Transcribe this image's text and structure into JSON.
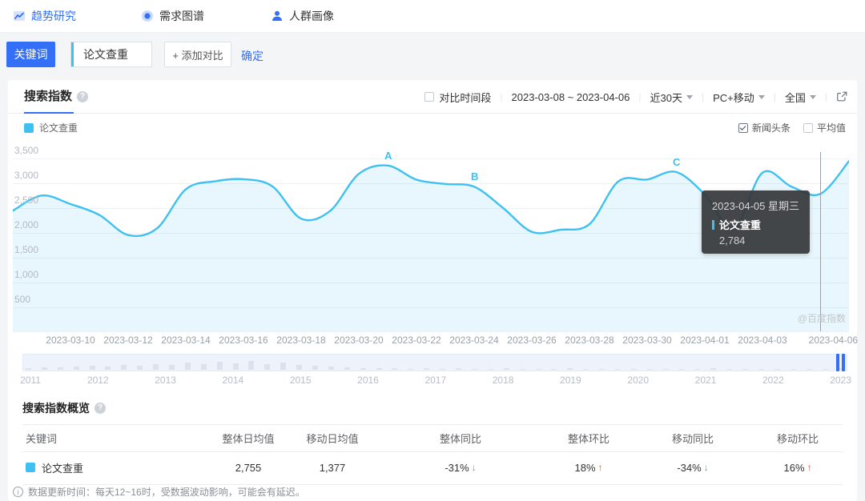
{
  "nav": {
    "items": [
      {
        "label": "趋势研究",
        "active": true
      },
      {
        "label": "需求图谱",
        "active": false
      },
      {
        "label": "人群画像",
        "active": false
      }
    ]
  },
  "query_bar": {
    "keyword_button": "关键词",
    "keyword_value": "论文查重",
    "add_compare": "+ 添加对比",
    "confirm": "确定"
  },
  "panel": {
    "tab": "搜索指数",
    "controls": {
      "compare_period": "对比时间段",
      "date_range": "2023-03-08 ~ 2023-04-06",
      "range_select": "近30天",
      "device_select": "PC+移动",
      "region_select": "全国"
    },
    "legend_keyword": "论文查重",
    "toggles": [
      {
        "label": "新闻头条",
        "checked": true
      },
      {
        "label": "平均值",
        "checked": false
      }
    ]
  },
  "chart_data": {
    "type": "line",
    "title": "搜索指数",
    "x": [
      "2023-03-08",
      "2023-03-09",
      "2023-03-10",
      "2023-03-11",
      "2023-03-12",
      "2023-03-13",
      "2023-03-14",
      "2023-03-15",
      "2023-03-16",
      "2023-03-17",
      "2023-03-18",
      "2023-03-19",
      "2023-03-20",
      "2023-03-21",
      "2023-03-22",
      "2023-03-23",
      "2023-03-24",
      "2023-03-25",
      "2023-03-26",
      "2023-03-27",
      "2023-03-28",
      "2023-03-29",
      "2023-03-30",
      "2023-03-31",
      "2023-04-01",
      "2023-04-02",
      "2023-04-03",
      "2023-04-04",
      "2023-04-05",
      "2023-04-06"
    ],
    "series": [
      {
        "name": "论文查重",
        "color": "#3ec1f0",
        "values": [
          2447,
          2753,
          2581,
          2362,
          1956,
          2091,
          2878,
          3040,
          3082,
          2940,
          2287,
          2440,
          3190,
          3358,
          3072,
          2986,
          2931,
          2504,
          2022,
          2063,
          2176,
          3038,
          3075,
          3228,
          2773,
          2080,
          3214,
          2934,
          2784,
          3446
        ]
      }
    ],
    "ylim": [
      0,
      3500
    ],
    "y_ticks": [
      500,
      1000,
      1500,
      2000,
      2500,
      3000,
      3500
    ],
    "x_tick_labels": [
      {
        "i": 2,
        "t": "2023-03-10"
      },
      {
        "i": 4,
        "t": "2023-03-12"
      },
      {
        "i": 6,
        "t": "2023-03-14"
      },
      {
        "i": 8,
        "t": "2023-03-16"
      },
      {
        "i": 10,
        "t": "2023-03-18"
      },
      {
        "i": 12,
        "t": "2023-03-20"
      },
      {
        "i": 14,
        "t": "2023-03-22"
      },
      {
        "i": 16,
        "t": "2023-03-24"
      },
      {
        "i": 18,
        "t": "2023-03-26"
      },
      {
        "i": 20,
        "t": "2023-03-28"
      },
      {
        "i": 22,
        "t": "2023-03-30"
      },
      {
        "i": 24,
        "t": "2023-04-01"
      },
      {
        "i": 26,
        "t": "2023-04-03"
      },
      {
        "i": 29,
        "t": "2023-04-06"
      }
    ],
    "markers": [
      {
        "label": "A",
        "x": "2023-03-21"
      },
      {
        "label": "B",
        "x": "2023-03-24"
      },
      {
        "label": "C",
        "x": "2023-03-31"
      }
    ],
    "crosshair_x": "2023-04-05",
    "grid": true,
    "legend_position": "top-left"
  },
  "tooltip": {
    "date": "2023-04-05 星期三",
    "series": "论文查重",
    "value": "2,784"
  },
  "watermark": "@百度指数",
  "timeline": {
    "years": [
      "2011",
      "2012",
      "2013",
      "2014",
      "2015",
      "2016",
      "2017",
      "2018",
      "2019",
      "2020",
      "2021",
      "2022",
      "2023"
    ],
    "sparkline": [
      2,
      3,
      3,
      4,
      5,
      4,
      6,
      5,
      7,
      6,
      9,
      7,
      10,
      8,
      11,
      7,
      9,
      6,
      5,
      4,
      3,
      2,
      2,
      2,
      1,
      2,
      1,
      2,
      1,
      1,
      2,
      1,
      1,
      1,
      2,
      1,
      1,
      1,
      1,
      1,
      1,
      1,
      1,
      2,
      1,
      1,
      1,
      1,
      1,
      1,
      1,
      2
    ]
  },
  "overview": {
    "title": "搜索指数概览",
    "columns": [
      "关键词",
      "整体日均值",
      "移动日均值",
      "整体同比",
      "整体环比",
      "移动同比",
      "移动环比"
    ],
    "row": {
      "keyword": "论文查重",
      "overall_daily": "2,755",
      "mobile_daily": "1,377",
      "overall_yoy": {
        "value": "-31%",
        "dir": "down"
      },
      "overall_mom": {
        "value": "18%",
        "dir": "up"
      },
      "mobile_yoy": {
        "value": "-34%",
        "dir": "down"
      },
      "mobile_mom": {
        "value": "16%",
        "dir": "up"
      }
    },
    "footnote": "数据更新时间：每天12~16时，受数据波动影响，可能会有延迟。"
  }
}
